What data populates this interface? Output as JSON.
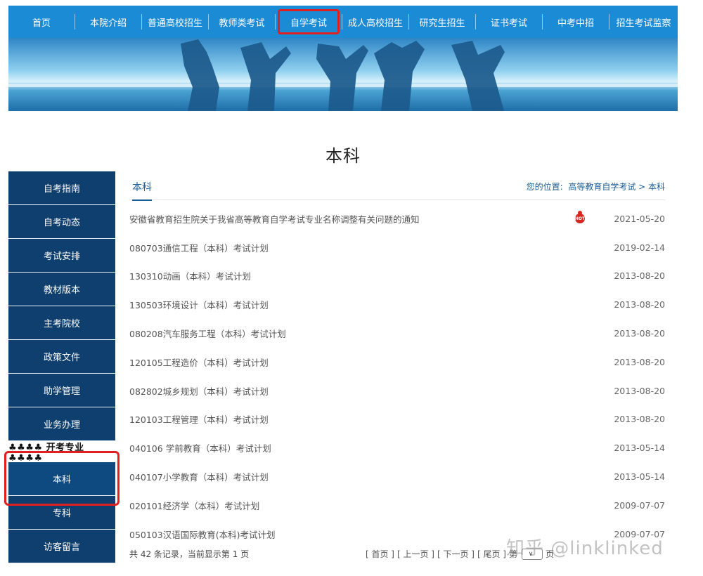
{
  "nav": {
    "items": [
      {
        "label": "首页"
      },
      {
        "label": "本院介绍"
      },
      {
        "label": "普通高校招生"
      },
      {
        "label": "教师类考试"
      },
      {
        "label": "自学考试"
      },
      {
        "label": "成人高校招生"
      },
      {
        "label": "研究生招生"
      },
      {
        "label": "证书考试"
      },
      {
        "label": "中考中招"
      },
      {
        "label": "招生考试监察"
      }
    ],
    "active_index": 4
  },
  "page_title": "本科",
  "sidebar": {
    "items": [
      {
        "label": "自考指南"
      },
      {
        "label": "自考动态"
      },
      {
        "label": "考试安排"
      },
      {
        "label": "教材版本"
      },
      {
        "label": "主考院校"
      },
      {
        "label": "政策文件"
      },
      {
        "label": "助学管理"
      },
      {
        "label": "业务办理"
      }
    ],
    "section_label": "♣♣♣♣ 开考专业 ♣♣♣♣",
    "sub_items": [
      {
        "label": "本科",
        "active": true
      },
      {
        "label": "专科"
      },
      {
        "label": "访客留言"
      }
    ]
  },
  "content": {
    "tab_title": "本科",
    "location_prefix": "您的位置:",
    "location_path": "高等教育自学考试 > 本科",
    "hot_badge": "HOT",
    "rows": [
      {
        "title": "安徽省教育招生院关于我省高等教育自学考试专业名称调整有关问题的通知",
        "date": "2021-05-20",
        "hot": true
      },
      {
        "title": "080703通信工程（本科）考试计划",
        "date": "2019-02-14"
      },
      {
        "title": "130310动画（本科）考试计划",
        "date": "2013-08-20"
      },
      {
        "title": "130503环境设计（本科）考试计划",
        "date": "2013-08-20"
      },
      {
        "title": "080208汽车服务工程（本科）考试计划",
        "date": "2013-08-20"
      },
      {
        "title": "120105工程造价（本科）考试计划",
        "date": "2013-08-20"
      },
      {
        "title": "082802城乡规划（本科）考试计划",
        "date": "2013-08-20"
      },
      {
        "title": "120103工程管理（本科）考试计划",
        "date": "2013-08-20"
      },
      {
        "title": "040106 学前教育（本科）考试计划",
        "date": "2013-05-14"
      },
      {
        "title": "040107小学教育（本科）考试计划",
        "date": "2013-05-14"
      },
      {
        "title": "020101经济学（本科）考试计划",
        "date": "2009-07-07"
      },
      {
        "title": "050103汉语国际教育(本科)考试计划",
        "date": "2009-07-07"
      }
    ],
    "summary": "共 42 条记录，当前显示第 1 页",
    "pager": {
      "first": "[ 首页 ]",
      "prev": "[ 上一页 ]",
      "next": "[ 下一页 ]",
      "last": "[ 尾页 ]",
      "goto_prefix": "第",
      "goto_suffix": "页",
      "select_icon": "chevron-down-icon"
    }
  },
  "watermark": "知乎 @linklinked",
  "colors": {
    "nav_bg": "#1b8bd6",
    "sidebar_bg": "#0e3f6e",
    "highlight": "#e02020",
    "link": "#1b5f99"
  }
}
